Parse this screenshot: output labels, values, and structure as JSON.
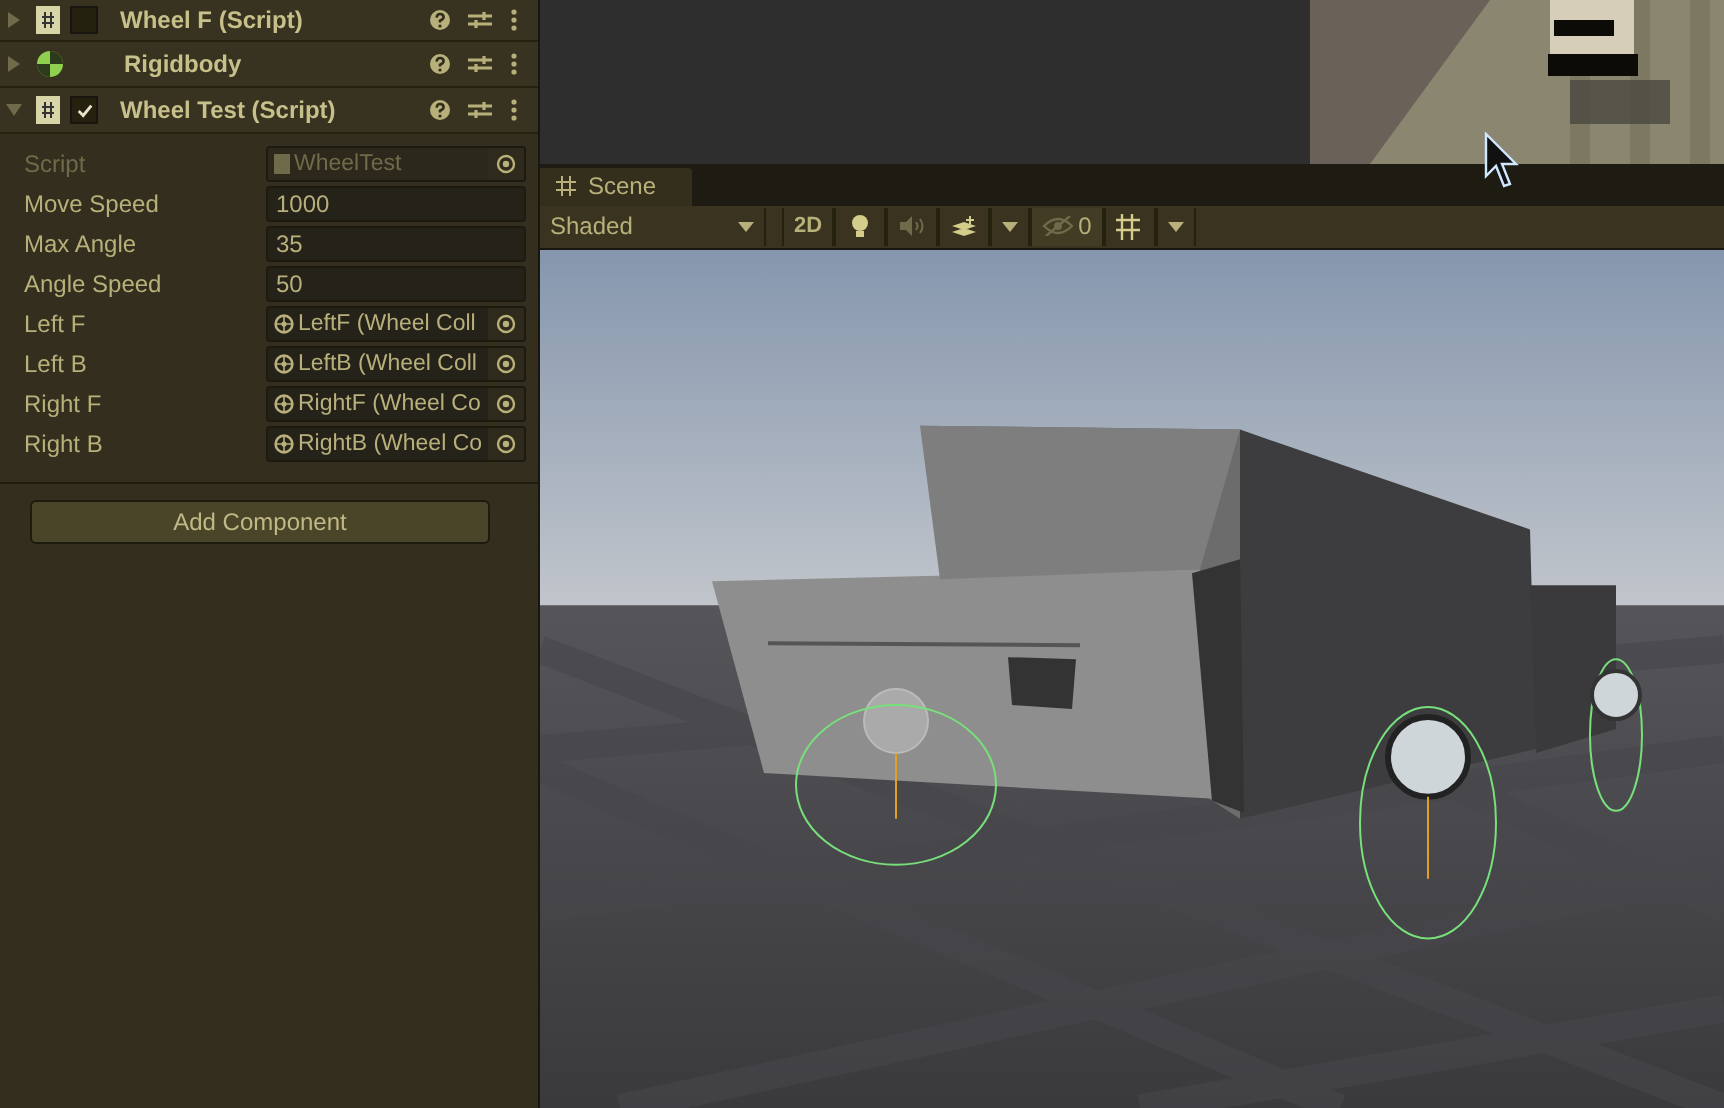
{
  "inspector": {
    "components": [
      {
        "title": "Wheel F (Script)",
        "kind": "script",
        "checked": false,
        "expanded": false
      },
      {
        "title": "Rigidbody",
        "kind": "rigidbody",
        "expanded": false
      },
      {
        "title": "Wheel Test (Script)",
        "kind": "script",
        "checked": true,
        "expanded": true
      }
    ],
    "fields": [
      {
        "label": "Script",
        "kind": "script",
        "value": "WheelTest",
        "disabled": true
      },
      {
        "label": "Move Speed",
        "kind": "number",
        "value": "1000",
        "disabled": false
      },
      {
        "label": "Max Angle",
        "kind": "number",
        "value": "35",
        "disabled": false
      },
      {
        "label": "Angle Speed",
        "kind": "number",
        "value": "50",
        "disabled": false
      },
      {
        "label": "Left F",
        "kind": "object",
        "value": "LeftF (Wheel Coll",
        "disabled": false
      },
      {
        "label": "Left B",
        "kind": "object",
        "value": "LeftB (Wheel Coll",
        "disabled": false
      },
      {
        "label": "Right F",
        "kind": "object",
        "value": "RightF (Wheel Co",
        "disabled": false
      },
      {
        "label": "Right B",
        "kind": "object",
        "value": "RightB (Wheel Co",
        "disabled": false
      }
    ],
    "add_button": "Add Component"
  },
  "scene": {
    "tab": "Scene",
    "shading": "Shaded",
    "mode_2d": "2D",
    "hidden_count": "0"
  }
}
